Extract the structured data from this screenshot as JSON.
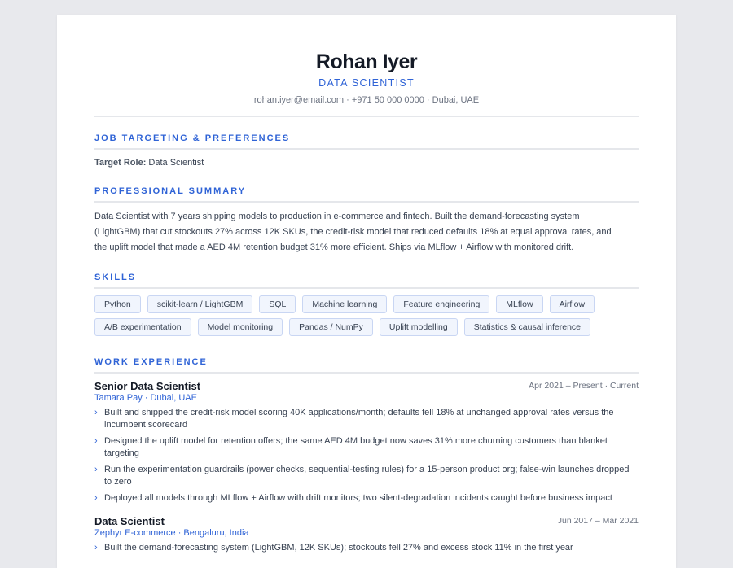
{
  "header": {
    "name": "Rohan Iyer",
    "title": "DATA SCIENTIST",
    "contact": "rohan.iyer@email.com · +971 50 000 0000 · Dubai, UAE"
  },
  "sections": {
    "targeting": {
      "heading": "JOB TARGETING & PREFERENCES",
      "target_role_label": "Target Role:",
      "target_role_value": "Data Scientist"
    },
    "summary": {
      "heading": "PROFESSIONAL SUMMARY",
      "lines": [
        "Data Scientist with 7 years shipping models to production in e-commerce and fintech. Built the demand-forecasting system",
        "(LightGBM) that cut stockouts 27% across 12K SKUs, the credit-risk model that reduced defaults 18% at equal approval rates, and",
        "the uplift model that made a AED 4M retention budget 31% more efficient. Ships via MLflow + Airflow with monitored drift."
      ]
    },
    "skills": {
      "heading": "SKILLS",
      "row1": [
        "Python",
        "scikit-learn / LightGBM",
        "SQL",
        "Machine learning",
        "Feature engineering",
        "MLflow",
        "Airflow"
      ],
      "row2": [
        "A/B experimentation",
        "Model monitoring",
        "Pandas / NumPy",
        "Uplift modelling",
        "Statistics & causal inference"
      ]
    },
    "experience": {
      "heading": "WORK EXPERIENCE",
      "jobs": [
        {
          "role": "Senior Data Scientist",
          "dates": "Apr 2021 – Present · Current",
          "company": "Tamara Pay · Dubai, UAE",
          "bullets": [
            "Built and shipped the credit-risk model scoring 40K applications/month; defaults fell 18% at unchanged approval rates versus the incumbent scorecard",
            "Designed the uplift model for retention offers; the same AED 4M budget now saves 31% more churning customers than blanket targeting",
            "Run the experimentation guardrails (power checks, sequential-testing rules) for a 15-person product org; false-win launches dropped to zero",
            "Deployed all models through MLflow + Airflow with drift monitors; two silent-degradation incidents caught before business impact"
          ]
        },
        {
          "role": "Data Scientist",
          "dates": "Jun 2017 – Mar 2021",
          "company": "Zephyr E-commerce · Bengaluru, India",
          "bullets": [
            "Built the demand-forecasting system (LightGBM, 12K SKUs); stockouts fell 27% and excess stock 11% in the first year"
          ]
        }
      ]
    }
  },
  "icons": {
    "bullet": "chevron-right-icon"
  },
  "colors": {
    "accent": "#2f63d6",
    "chip_bg": "#f1f5fd",
    "chip_border": "#c9d6f3",
    "page_bg": "#e8e9ed"
  }
}
